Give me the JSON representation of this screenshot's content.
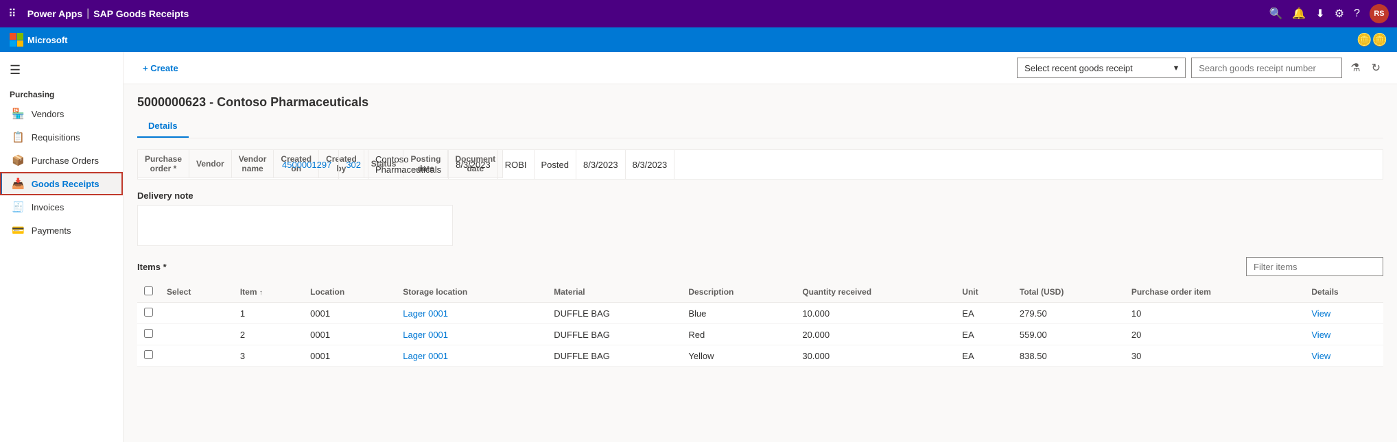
{
  "app": {
    "top_bar": {
      "app_name": "Power Apps",
      "separator": "|",
      "module_name": "SAP Goods Receipts",
      "avatar_text": "RS"
    },
    "brand_bar": {
      "brand_name": "Microsoft"
    }
  },
  "toolbar": {
    "create_label": "+ Create",
    "select_placeholder": "Select recent goods receipt",
    "search_placeholder": "Search goods receipt number"
  },
  "sidebar": {
    "section_label": "Purchasing",
    "items": [
      {
        "id": "vendors",
        "label": "Vendors",
        "icon": "🏪"
      },
      {
        "id": "requisitions",
        "label": "Requisitions",
        "icon": "📋"
      },
      {
        "id": "purchase-orders",
        "label": "Purchase Orders",
        "icon": "📦"
      },
      {
        "id": "goods-receipts",
        "label": "Goods Receipts",
        "icon": "📥",
        "active": true
      },
      {
        "id": "invoices",
        "label": "Invoices",
        "icon": "🧾"
      },
      {
        "id": "payments",
        "label": "Payments",
        "icon": "💳"
      }
    ]
  },
  "record": {
    "title": "5000000623 - Contoso Pharmaceuticals",
    "tabs": [
      {
        "id": "details",
        "label": "Details",
        "active": true
      }
    ],
    "form": {
      "columns": [
        "Purchase order *",
        "Vendor",
        "Vendor name",
        "Created on",
        "Created by",
        "Status",
        "Posting date",
        "Document date"
      ],
      "values": {
        "purchase_order": "4500001297",
        "vendor": "302",
        "vendor_name": "Contoso Pharmaceuticals",
        "created_on": "8/3/2023",
        "created_by": "ROBI",
        "status": "Posted",
        "posting_date": "8/3/2023",
        "document_date": "8/3/2023"
      }
    },
    "delivery_note_label": "Delivery note",
    "items_label": "Items *",
    "filter_placeholder": "Filter items",
    "table": {
      "columns": [
        {
          "id": "select",
          "label": "Select"
        },
        {
          "id": "item",
          "label": "Item",
          "sortable": true
        },
        {
          "id": "location",
          "label": "Location"
        },
        {
          "id": "storage_location",
          "label": "Storage location"
        },
        {
          "id": "material",
          "label": "Material"
        },
        {
          "id": "description",
          "label": "Description"
        },
        {
          "id": "quantity_received",
          "label": "Quantity received"
        },
        {
          "id": "unit",
          "label": "Unit"
        },
        {
          "id": "total_usd",
          "label": "Total (USD)"
        },
        {
          "id": "purchase_order_item",
          "label": "Purchase order item"
        },
        {
          "id": "details",
          "label": "Details"
        }
      ],
      "rows": [
        {
          "item": "1",
          "location": "0001",
          "storage_location": "Lager 0001",
          "material": "DUFFLE BAG",
          "description": "Blue",
          "quantity_received": "10.000",
          "unit": "EA",
          "total_usd": "279.50",
          "purchase_order_item": "10",
          "details_link": "View"
        },
        {
          "item": "2",
          "location": "0001",
          "storage_location": "Lager 0001",
          "material": "DUFFLE BAG",
          "description": "Red",
          "quantity_received": "20.000",
          "unit": "EA",
          "total_usd": "559.00",
          "purchase_order_item": "20",
          "details_link": "View"
        },
        {
          "item": "3",
          "location": "0001",
          "storage_location": "Lager 0001",
          "material": "DUFFLE BAG",
          "description": "Yellow",
          "quantity_received": "30.000",
          "unit": "EA",
          "total_usd": "838.50",
          "purchase_order_item": "30",
          "details_link": "View"
        }
      ]
    }
  }
}
